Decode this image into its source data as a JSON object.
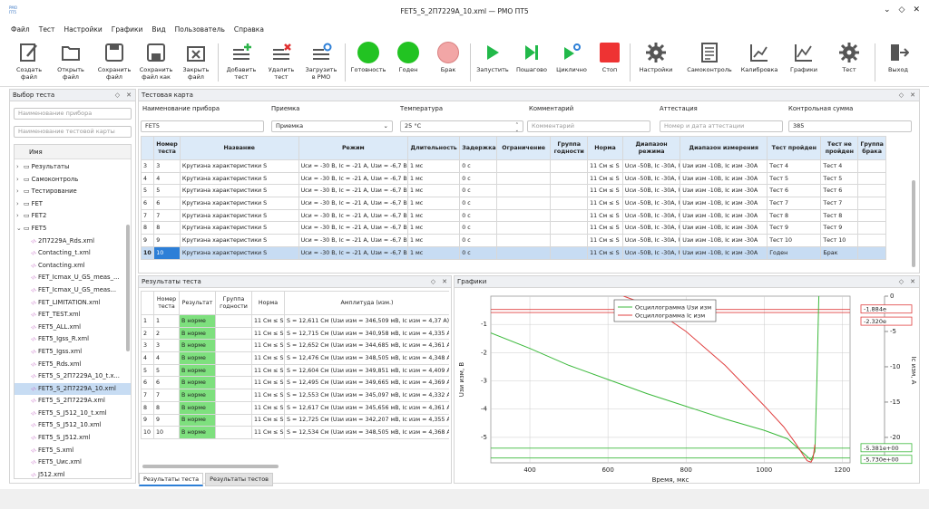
{
  "app": {
    "logo_text": "РМО ПТ5",
    "title": "FET5_S_2П7229А_10.xml — РМО ПТ5"
  },
  "menu": [
    "Файл",
    "Тест",
    "Настройки",
    "Графики",
    "Вид",
    "Пользователь",
    "Справка"
  ],
  "toolbar": {
    "create": "Создать файл",
    "open": "Открыть файл",
    "save": "Сохранить файл",
    "save_as": "Сохранить файл как",
    "close": "Закрыть файл",
    "add_test": "Добавить тест",
    "del_test": "Удалить тест",
    "load": "Загрузить в РМО",
    "ready": "Готовность",
    "good": "Годен",
    "bad": "Брак",
    "run": "Запустить",
    "step": "Пошагово",
    "cycle": "Циклично",
    "stop": "Стоп",
    "settings": "Настройки",
    "selfcheck": "Самоконтроль",
    "calib": "Калибровка",
    "graphs": "Графики",
    "test": "Тест",
    "exit": "Выход",
    "colors": {
      "ready": "#22c322",
      "good": "#22c322",
      "bad": "#f2a6a6",
      "run": "#22b94a",
      "stop": "#ee3333"
    }
  },
  "left": {
    "title": "Выбор теста",
    "device_placeholder": "Наименование прибора",
    "card_placeholder": "Наименование тестовой карты",
    "col_name": "Имя",
    "folders": [
      "Результаты",
      "Самоконтроль",
      "Тестирование",
      "FET",
      "FET2",
      "FET5"
    ],
    "files": [
      "2П7229А_Rds.xml",
      "Contacting_t.xml",
      "Contacting.xml",
      "FET_Icmax_U_GS_meas_...",
      "FET_Icmax_U_GS_meas...",
      "FET_LIMITATION.xml",
      "FET_TEST.xml",
      "FET5_ALL.xml",
      "FET5_Igss_R.xml",
      "FET5_Igss.xml",
      "FET5_Rds.xml",
      "FET5_S_2П7229А_10_t.x...",
      "FET5_S_2П7229А_10.xml",
      "FET5_S_2П7229А.xml",
      "FET5_S_J512_10_t.xml",
      "FET5_S_J512_10.xml",
      "FET5_S_J512.xml",
      "FET5_S.xml",
      "FET5_Uис.xml",
      "J512.xml"
    ]
  },
  "card": {
    "title": "Тестовая карта",
    "labels": {
      "device": "Наименование прибора",
      "accept": "Приемка",
      "temp": "Температура",
      "comment": "Комментарий",
      "attest": "Аттестация",
      "checksum": "Контрольная сумма"
    },
    "values": {
      "device": "FET5",
      "accept": "Приемка",
      "temp": "25 °C",
      "comment_ph": "Комментарий",
      "attest_ph": "Номер и дата аттестации",
      "checksum": "385"
    },
    "headers": [
      "Номер теста",
      "Название",
      "Режим",
      "Длительность",
      "Задержка",
      "Ограничение",
      "Группа годности",
      "Норма",
      "Диапазон режима",
      "Диапазон измерения",
      "Тест пройден",
      "Тест не пройден",
      "Группа брака"
    ],
    "rows": [
      [
        "3",
        "3",
        "Крутизна характеристики S",
        "Uси = -30 В, Ic = -21 А, Uзи = -6,7 В",
        "1 мс",
        "0 с",
        "",
        "",
        "11 См ≤ S",
        "Uси -50В, Ic -30А, Uзи -30В",
        "Uзи изм -10В, Ic изм -30А",
        "Тест 4",
        "Тест 4",
        ""
      ],
      [
        "4",
        "4",
        "Крутизна характеристики S",
        "Uси = -30 В, Ic = -21 А, Uзи = -6,7 В",
        "1 мс",
        "0 с",
        "",
        "",
        "11 См ≤ S",
        "Uси -50В, Ic -30А, Uзи -30В",
        "Uзи изм -10В, Ic изм -30А",
        "Тест 5",
        "Тест 5",
        ""
      ],
      [
        "5",
        "5",
        "Крутизна характеристики S",
        "Uси = -30 В, Ic = -21 А, Uзи = -6,7 В",
        "1 мс",
        "0 с",
        "",
        "",
        "11 См ≤ S",
        "Uси -50В, Ic -30А, Uзи -30В",
        "Uзи изм -10В, Ic изм -30А",
        "Тест 6",
        "Тест 6",
        ""
      ],
      [
        "6",
        "6",
        "Крутизна характеристики S",
        "Uси = -30 В, Ic = -21 А, Uзи = -6,7 В",
        "1 мс",
        "0 с",
        "",
        "",
        "11 См ≤ S",
        "Uси -50В, Ic -30А, Uзи -30В",
        "Uзи изм -10В, Ic изм -30А",
        "Тест 7",
        "Тест 7",
        ""
      ],
      [
        "7",
        "7",
        "Крутизна характеристики S",
        "Uси = -30 В, Ic = -21 А, Uзи = -6,7 В",
        "1 мс",
        "0 с",
        "",
        "",
        "11 См ≤ S",
        "Uси -50В, Ic -30А, Uзи -30В",
        "Uзи изм -10В, Ic изм -30А",
        "Тест 8",
        "Тест 8",
        ""
      ],
      [
        "8",
        "8",
        "Крутизна характеристики S",
        "Uси = -30 В, Ic = -21 А, Uзи = -6,7 В",
        "1 мс",
        "0 с",
        "",
        "",
        "11 См ≤ S",
        "Uси -50В, Ic -30А, Uзи -30В",
        "Uзи изм -10В, Ic изм -30А",
        "Тест 9",
        "Тест 9",
        ""
      ],
      [
        "9",
        "9",
        "Крутизна характеристики S",
        "Uси = -30 В, Ic = -21 А, Uзи = -6,7 В",
        "1 мс",
        "0 с",
        "",
        "",
        "11 См ≤ S",
        "Uси -50В, Ic -30А, Uзи -30В",
        "Uзи изм -10В, Ic изм -30А",
        "Тест 10",
        "Тест 10",
        ""
      ],
      [
        "10",
        "10",
        "Крутизна характеристики S",
        "Uси = -30 В, Ic = -21 А, Uзи = -6,7 В",
        "1 мс",
        "0 с",
        "",
        "",
        "11 См ≤ S",
        "Uси -50В, Ic -30А, Uзи -30В",
        "Uзи изм -10В, Ic изм -30А",
        "Годен",
        "Брак",
        ""
      ]
    ]
  },
  "results": {
    "title": "Результаты теста",
    "headers": [
      "Номер теста",
      "Результат",
      "Группа годности",
      "Норма",
      "Амплитуда (изм.)"
    ],
    "rows": [
      [
        "1",
        "1",
        "В норме",
        "",
        "11 См ≤ S",
        "S = 12,611 См (Uзи изм = 346,509 мВ, Ic изм = 4,37 А)"
      ],
      [
        "2",
        "2",
        "В норме",
        "",
        "11 См ≤ S",
        "S = 12,715 См (Uзи изм = 340,958 мВ, Ic изм = 4,335 А)"
      ],
      [
        "3",
        "3",
        "В норме",
        "",
        "11 См ≤ S",
        "S = 12,652 См (Uзи изм = 344,685 мВ, Ic изм = 4,361 А)"
      ],
      [
        "4",
        "4",
        "В норме",
        "",
        "11 См ≤ S",
        "S = 12,476 См (Uзи изм = 348,505 мВ, Ic изм = 4,348 А)"
      ],
      [
        "5",
        "5",
        "В норме",
        "",
        "11 См ≤ S",
        "S = 12,604 См (Uзи изм = 349,851 мВ, Ic изм = 4,409 А)"
      ],
      [
        "6",
        "6",
        "В норме",
        "",
        "11 См ≤ S",
        "S = 12,495 См (Uзи изм = 349,665 мВ, Ic изм = 4,369 А)"
      ],
      [
        "7",
        "7",
        "В норме",
        "",
        "11 См ≤ S",
        "S = 12,553 См (Uзи изм = 345,097 мВ, Ic изм = 4,332 А)"
      ],
      [
        "8",
        "8",
        "В норме",
        "",
        "11 См ≤ S",
        "S = 12,617 См (Uзи изм = 345,656 мВ, Ic изм = 4,361 А)"
      ],
      [
        "9",
        "9",
        "В норме",
        "",
        "11 См ≤ S",
        "S = 12,725 См (Uзи изм = 342,207 мВ, Ic изм = 4,355 А)"
      ],
      [
        "10",
        "10",
        "В норме",
        "",
        "11 См ≤ S",
        "S = 12,534 См (Uзи изм = 348,505 мВ, Ic изм = 4,368 А)"
      ]
    ],
    "tabs": [
      "Результаты теста",
      "Результаты тестов"
    ]
  },
  "graph": {
    "title": "Графики",
    "xlabel": "Время, мкс",
    "ylabel_left": "Uзи изм, В",
    "ylabel_right": "Ic изм, А",
    "x_ticks": [
      "400",
      "600",
      "800",
      "1000",
      "1200"
    ],
    "y_left_ticks": [
      "-1",
      "-2",
      "-3",
      "-4",
      "-5"
    ],
    "y_right_ticks": [
      "0",
      "-5",
      "-10",
      "-15",
      "-20"
    ],
    "legend": [
      "Осциллограмма Uзи изм",
      "Осциллограмма Ic изм"
    ],
    "markers": {
      "r1": "-1.884e",
      "r2": "-2.320e",
      "g1": "-5.381e+00",
      "g2": "-5.730e+00"
    },
    "colors": {
      "uzi": "#3cb93c",
      "ic": "#e04040"
    }
  },
  "chart_data": {
    "type": "line",
    "xlabel": "Время, мкс",
    "ylabel": "Uзи изм, В",
    "ylabel_right": "Ic изм, А",
    "xlim": [
      300,
      1220
    ],
    "ylim": [
      -5.9,
      0
    ],
    "ylim_right": [
      -23.6,
      0
    ],
    "series": [
      {
        "name": "Осциллограмма Uзи изм",
        "axis": "left",
        "color": "#3cb93c",
        "x": [
          300,
          400,
          500,
          600,
          700,
          800,
          900,
          1000,
          1060,
          1100,
          1120,
          1130,
          1135,
          1140
        ],
        "y": [
          -1.3,
          -1.85,
          -2.45,
          -2.95,
          -3.45,
          -3.9,
          -4.35,
          -4.75,
          -5.05,
          -5.55,
          -5.8,
          -5.5,
          -3.0,
          0
        ]
      },
      {
        "name": "Осциллограмма Ic изм",
        "axis": "right",
        "color": "#e04040",
        "x": [
          640,
          700,
          800,
          900,
          1000,
          1050,
          1080,
          1100,
          1110,
          1120,
          1125,
          1130
        ],
        "y": [
          0,
          -1.2,
          -5.0,
          -9.8,
          -15.5,
          -18.5,
          -20.8,
          -22.5,
          -23.3,
          -23.5,
          -23.0,
          -21.0
        ]
      }
    ],
    "h_lines": [
      {
        "axis": "right",
        "value": -1.884,
        "color": "#e04040"
      },
      {
        "axis": "right",
        "value": -2.32,
        "color": "#e04040"
      },
      {
        "axis": "left",
        "value": -5.381,
        "color": "#3cb93c"
      },
      {
        "axis": "left",
        "value": -5.73,
        "color": "#3cb93c"
      }
    ],
    "legend_position": "top"
  }
}
